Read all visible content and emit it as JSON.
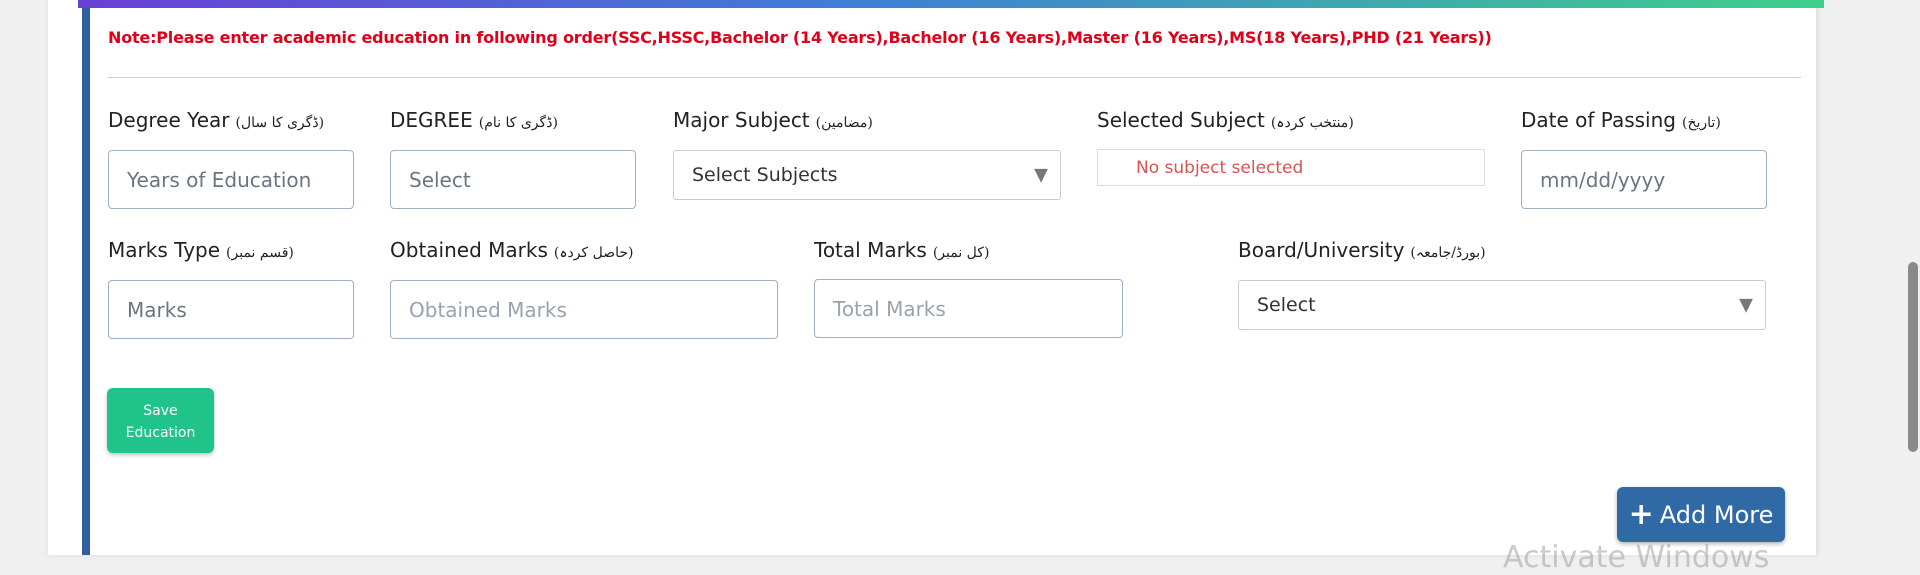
{
  "note": "Note:Please enter academic education in following order(SSC,HSSC,Bachelor (14 Years),Bachelor (16 Years),Master (16 Years),MS(18 Years),PHD (21 Years))",
  "fields": {
    "degree_year": {
      "label": "Degree Year",
      "urdu": "(ڈگری کا سال)",
      "placeholder": "Years of Education"
    },
    "degree": {
      "label": "DEGREE",
      "urdu": "(ڈگری کا نام)",
      "value": "Select"
    },
    "major_subject": {
      "label": "Major Subject",
      "urdu": "(مضامین)",
      "value": "Select Subjects"
    },
    "selected_subject": {
      "label": "Selected Subject",
      "urdu": "(منتخب کردہ)",
      "value": "No subject selected"
    },
    "date_of_passing": {
      "label": "Date of Passing",
      "urdu": "(تاریخ)",
      "placeholder": "mm/dd/yyyy"
    },
    "marks_type": {
      "label": "Marks Type",
      "urdu": "(قسم نمبر)",
      "value": "Marks"
    },
    "obtained_marks": {
      "label": "Obtained Marks",
      "urdu": "(حاصل کردہ)",
      "placeholder": "Obtained Marks"
    },
    "total_marks": {
      "label": "Total Marks",
      "urdu": "(کل نمبر)",
      "placeholder": "Total Marks"
    },
    "board_university": {
      "label": "Board/University",
      "urdu": "(بورڈ/جامعہ)",
      "value": "Select"
    }
  },
  "buttons": {
    "save": "Save\nEducation",
    "add_more": "Add More"
  },
  "watermark": "Activate Windows",
  "colors": {
    "note": "#e0001a",
    "save_button": "#20c48a",
    "add_button": "#2f6aa6",
    "left_stripe": "#2f5f9e",
    "selected_subject_text": "#d9534f"
  },
  "icons": {
    "dropdown": "caret-down-icon",
    "add": "plus-icon"
  }
}
